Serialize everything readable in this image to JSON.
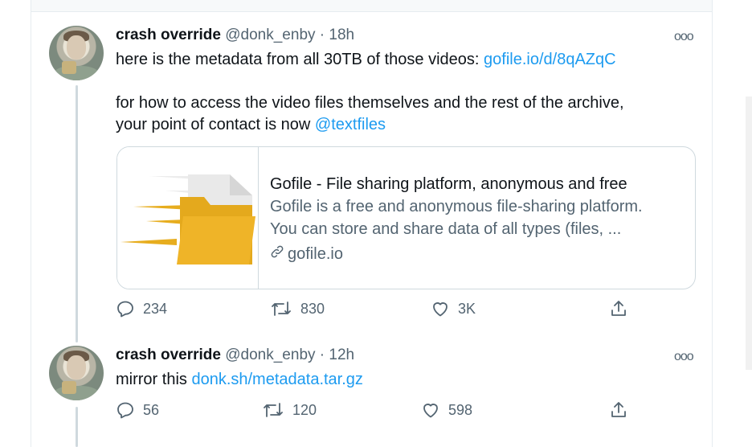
{
  "tweets": [
    {
      "display_name": "crash override",
      "handle": "@donk_enby",
      "separator": "·",
      "time": "18h",
      "more_label": "ooo",
      "text_line1_prefix": "here is the metadata from all 30TB of those videos: ",
      "text_line1_link": "gofile.io/d/8qAZqC",
      "text_line3": "for how to access the video files themselves and the rest of the archive,",
      "text_line4_prefix": "your point of contact is now ",
      "text_line4_mention": "@textfiles",
      "card": {
        "title": "Gofile - File sharing platform, anonymous and free",
        "description_line1": "Gofile is a free and anonymous file-sharing platform.",
        "description_line2": "You can store and share data of all types (files, ...",
        "domain": "gofile.io",
        "image_icon": "gofile-folder-logo",
        "colors": {
          "folder": "#e7ad1e",
          "paper": "#e8e8e8",
          "speed_lines": "#e7ad1e"
        }
      },
      "actions": {
        "reply": "234",
        "retweet": "830",
        "like": "3K"
      }
    },
    {
      "display_name": "crash override",
      "handle": "@donk_enby",
      "separator": "·",
      "time": "12h",
      "more_label": "ooo",
      "text_prefix": "mirror this ",
      "text_link": "donk.sh/metadata.tar.gz",
      "actions": {
        "reply": "56",
        "retweet": "120",
        "like": "598"
      }
    }
  ],
  "colors": {
    "link": "#1d9bf0",
    "secondary": "#536471",
    "border": "#cfd9de"
  }
}
